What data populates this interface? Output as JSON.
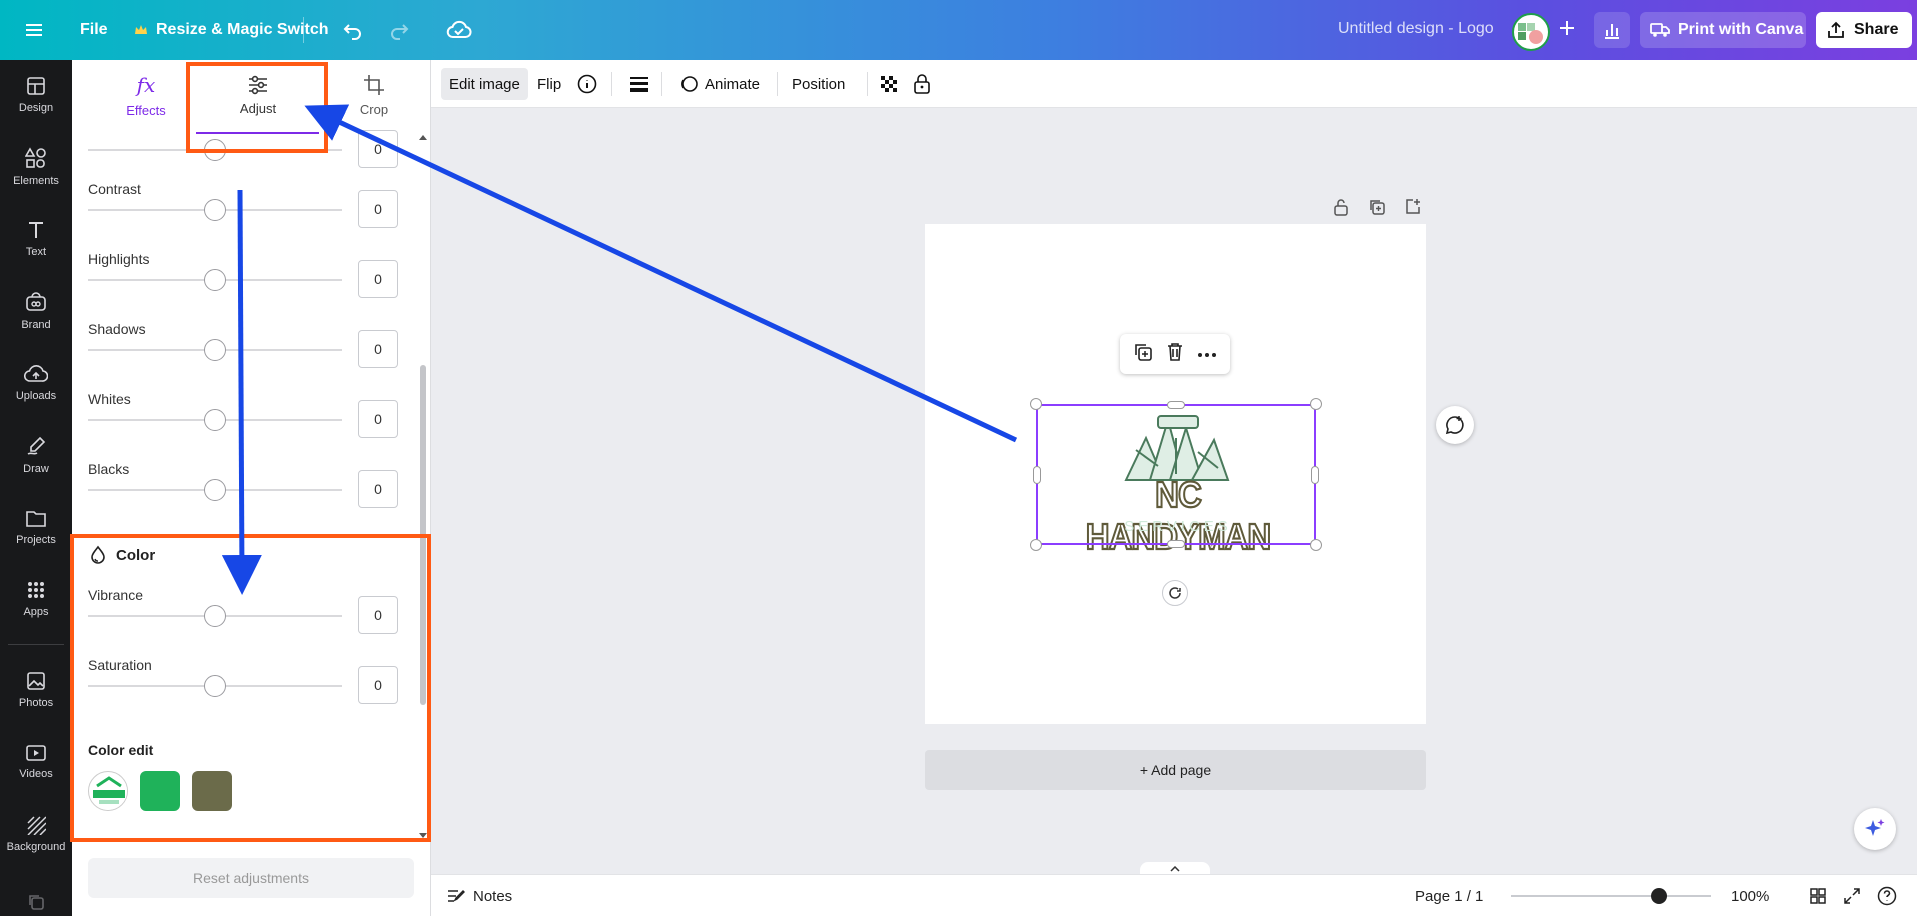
{
  "topbar": {
    "file_label": "File",
    "resize_label": "Resize & Magic Switch",
    "doc_title": "Untitled design - Logo",
    "print_label": "Print with Canva",
    "share_label": "Share"
  },
  "rail": {
    "items": [
      {
        "label": "Design",
        "icon": "design-icon"
      },
      {
        "label": "Elements",
        "icon": "elements-icon"
      },
      {
        "label": "Text",
        "icon": "text-icon"
      },
      {
        "label": "Brand",
        "icon": "brand-icon"
      },
      {
        "label": "Uploads",
        "icon": "uploads-icon"
      },
      {
        "label": "Draw",
        "icon": "draw-icon"
      },
      {
        "label": "Projects",
        "icon": "projects-icon"
      },
      {
        "label": "Apps",
        "icon": "apps-icon"
      },
      {
        "label": "Photos",
        "icon": "photos-icon"
      },
      {
        "label": "Videos",
        "icon": "videos-icon"
      },
      {
        "label": "Background",
        "icon": "background-icon"
      }
    ]
  },
  "panel": {
    "tabs": [
      {
        "label": "Effects",
        "icon": "fx-icon"
      },
      {
        "label": "Adjust",
        "icon": "sliders-icon"
      },
      {
        "label": "Crop",
        "icon": "crop-icon"
      }
    ],
    "active_tab": "Adjust",
    "sliders": {
      "top": {
        "label": "",
        "value": "0"
      },
      "contrast": {
        "label": "Contrast",
        "value": "0"
      },
      "highlights": {
        "label": "Highlights",
        "value": "0"
      },
      "shadows": {
        "label": "Shadows",
        "value": "0"
      },
      "whites": {
        "label": "Whites",
        "value": "0"
      },
      "blacks": {
        "label": "Blacks",
        "value": "0"
      },
      "vibrance": {
        "label": "Vibrance",
        "value": "0"
      },
      "saturation": {
        "label": "Saturation",
        "value": "0"
      }
    },
    "color_section_title": "Color",
    "color_edit_label": "Color edit",
    "swatches": [
      "#1fb25a",
      "#6b6b4a"
    ],
    "reset_label": "Reset adjustments"
  },
  "context_toolbar": {
    "edit_image": "Edit image",
    "flip": "Flip",
    "animate": "Animate",
    "position": "Position"
  },
  "canvas": {
    "logo_title": "NC HANDYMAN",
    "logo_subtitle": "SERVICES",
    "add_page": "+ Add page"
  },
  "bottombar": {
    "notes": "Notes",
    "page_indicator": "Page 1 / 1",
    "zoom": "100%",
    "zoom_fraction": 1.0
  },
  "colors": {
    "accent": "#8b3dff",
    "annotation_orange": "#ff5a14",
    "annotation_blue": "#1747e6"
  }
}
